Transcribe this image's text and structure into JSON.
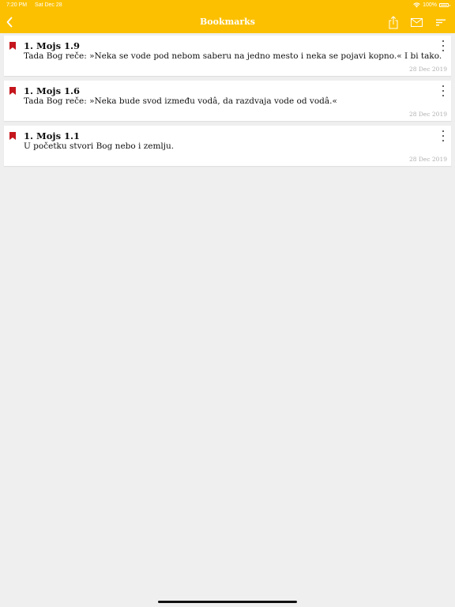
{
  "status_bar": {
    "time": "7:20 PM",
    "date": "Sat Dec 28",
    "battery": "100%",
    "icons": [
      "wifi-icon",
      "battery-icon"
    ]
  },
  "nav": {
    "title": "Bookmarks",
    "icons": [
      "back-chevron-icon",
      "share-icon",
      "mail-icon",
      "sort-icon"
    ],
    "bar_color": "#fcc000"
  },
  "bookmarks": [
    {
      "reference": "1. Mojs 1.9",
      "text": "Tada Bog reče: »Neka se vode pod nebom saberu na jedno mesto i neka se pojavi kopno.« I bi tako.",
      "date": "28 Dec 2019"
    },
    {
      "reference": "1. Mojs 1.6",
      "text": "Tada Bog reče: »Neka bude svod između vodâ, da razdvaja vode od vodâ.«",
      "date": "28 Dec 2019"
    },
    {
      "reference": "1. Mojs 1.1",
      "text": "U početku stvori Bog nebo i zemlju.",
      "date": "28 Dec 2019"
    }
  ],
  "colors": {
    "accent": "#fcc000",
    "bookmark_icon": "#c4161c",
    "background": "#efefef"
  }
}
